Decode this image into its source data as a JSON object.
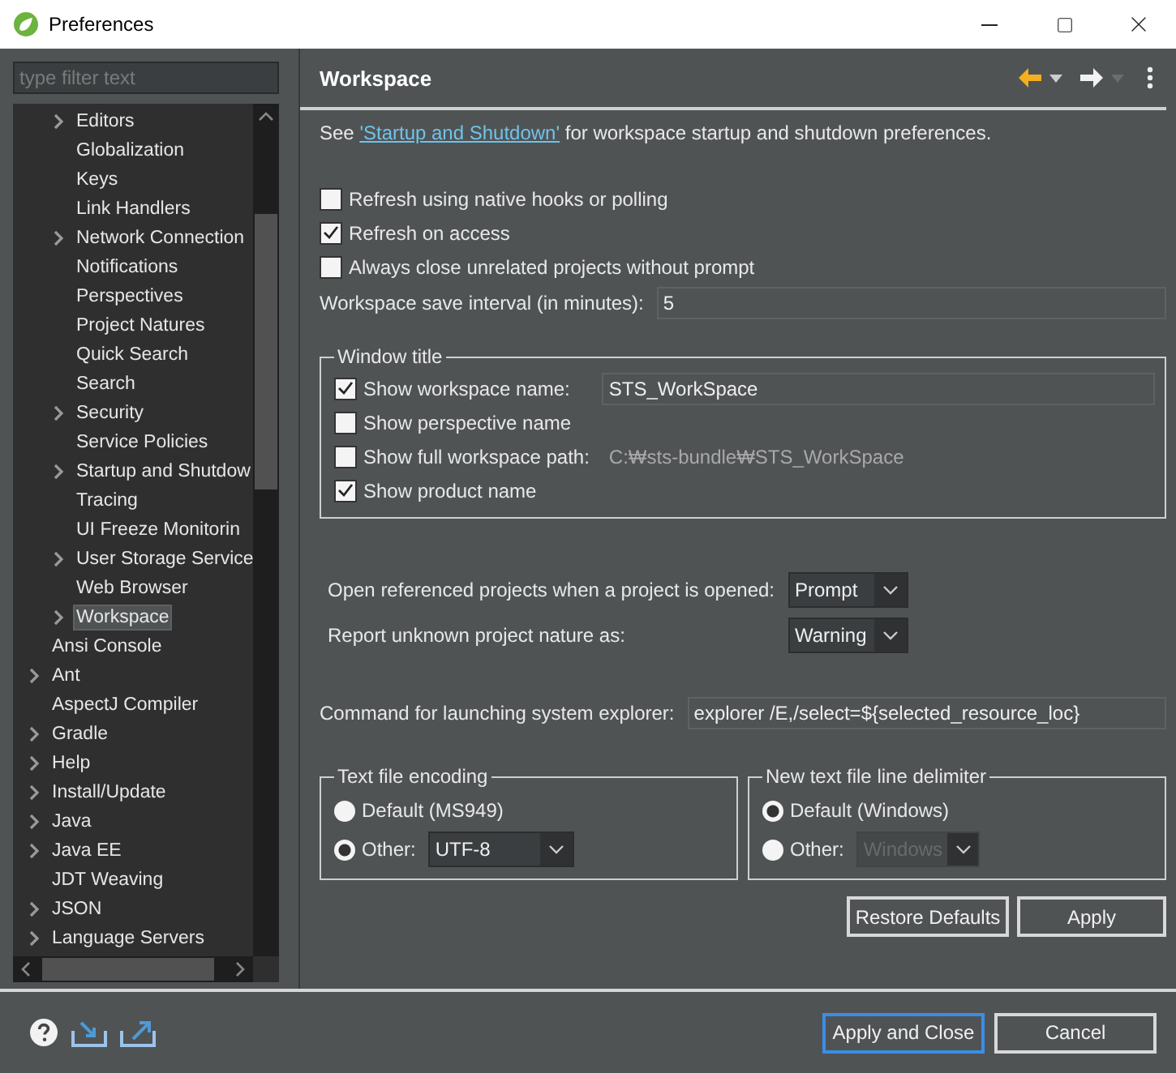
{
  "window": {
    "title": "Preferences"
  },
  "filter": {
    "placeholder": "type filter text"
  },
  "tree": {
    "hidden_parent_children": [
      {
        "label": "Editors",
        "expandable": true,
        "selected": false
      },
      {
        "label": "Globalization",
        "expandable": false,
        "selected": false
      },
      {
        "label": "Keys",
        "expandable": false,
        "selected": false
      },
      {
        "label": "Link Handlers",
        "expandable": false,
        "selected": false
      },
      {
        "label": "Network Connection",
        "expandable": true,
        "selected": false
      },
      {
        "label": "Notifications",
        "expandable": false,
        "selected": false
      },
      {
        "label": "Perspectives",
        "expandable": false,
        "selected": false
      },
      {
        "label": "Project Natures",
        "expandable": false,
        "selected": false
      },
      {
        "label": "Quick Search",
        "expandable": false,
        "selected": false
      },
      {
        "label": "Search",
        "expandable": false,
        "selected": false
      },
      {
        "label": "Security",
        "expandable": true,
        "selected": false
      },
      {
        "label": "Service Policies",
        "expandable": false,
        "selected": false
      },
      {
        "label": "Startup and Shutdow",
        "expandable": true,
        "selected": false
      },
      {
        "label": "Tracing",
        "expandable": false,
        "selected": false
      },
      {
        "label": "UI Freeze Monitorin",
        "expandable": false,
        "selected": false
      },
      {
        "label": "User Storage Service",
        "expandable": true,
        "selected": false
      },
      {
        "label": "Web Browser",
        "expandable": false,
        "selected": false
      },
      {
        "label": "Workspace",
        "expandable": true,
        "selected": true
      }
    ],
    "items": [
      {
        "label": "Ansi Console",
        "expandable": false,
        "selected": false
      },
      {
        "label": "Ant",
        "expandable": true,
        "selected": false
      },
      {
        "label": "AspectJ Compiler",
        "expandable": false,
        "selected": false
      },
      {
        "label": "Gradle",
        "expandable": true,
        "selected": false
      },
      {
        "label": "Help",
        "expandable": true,
        "selected": false
      },
      {
        "label": "Install/Update",
        "expandable": true,
        "selected": false
      },
      {
        "label": "Java",
        "expandable": true,
        "selected": false
      },
      {
        "label": "Java EE",
        "expandable": true,
        "selected": false
      },
      {
        "label": "JDT Weaving",
        "expandable": false,
        "selected": false
      },
      {
        "label": "JSON",
        "expandable": true,
        "selected": false
      },
      {
        "label": "Language Servers",
        "expandable": true,
        "selected": false
      }
    ]
  },
  "page": {
    "title": "Workspace",
    "intro": {
      "before": "See ",
      "link": "'Startup and Shutdown'",
      "after": " for workspace startup and shutdown preferences."
    },
    "options": [
      {
        "label": "Refresh using native hooks or polling",
        "checked": false
      },
      {
        "label": "Refresh on access",
        "checked": true
      },
      {
        "label": "Always close unrelated projects without prompt",
        "checked": false
      }
    ],
    "save_interval": {
      "label": "Workspace save interval (in minutes):",
      "value": "5"
    },
    "window_title": {
      "title": "Window title",
      "options": [
        {
          "label": "Show workspace name:",
          "checked": true,
          "kind": "field",
          "value": "STS_WorkSpace"
        },
        {
          "label": "Show perspective name",
          "checked": false,
          "kind": "plain"
        },
        {
          "label": "Show full workspace path:",
          "checked": false,
          "kind": "path",
          "value": "C:₩sts-bundle₩STS_WorkSpace"
        },
        {
          "label": "Show product name",
          "checked": true,
          "kind": "plain"
        }
      ]
    },
    "selects": [
      {
        "label": "Open referenced projects when a project is opened:",
        "value": "Prompt"
      },
      {
        "label": "Report unknown project nature as:",
        "value": "Warning"
      }
    ],
    "explorer": {
      "label": "Command for launching system explorer:",
      "value": "explorer /E,/select=${selected_resource_loc}"
    },
    "groups": [
      {
        "title": "Text file encoding",
        "options": [
          {
            "label": "Default (MS949)",
            "selected": false
          },
          {
            "label": "Other:",
            "selected": true,
            "select": {
              "value": "UTF-8",
              "disabled": false
            }
          }
        ]
      },
      {
        "title": "New text file line delimiter",
        "options": [
          {
            "label": "Default (Windows)",
            "selected": true
          },
          {
            "label": "Other:",
            "selected": false,
            "select": {
              "value": "Windows",
              "disabled": true
            }
          }
        ]
      }
    ],
    "buttons": [
      "Restore Defaults",
      "Apply"
    ]
  },
  "footer": {
    "buttons": [
      {
        "label": "Apply and Close",
        "default": true
      },
      {
        "label": "Cancel",
        "default": false
      }
    ]
  }
}
